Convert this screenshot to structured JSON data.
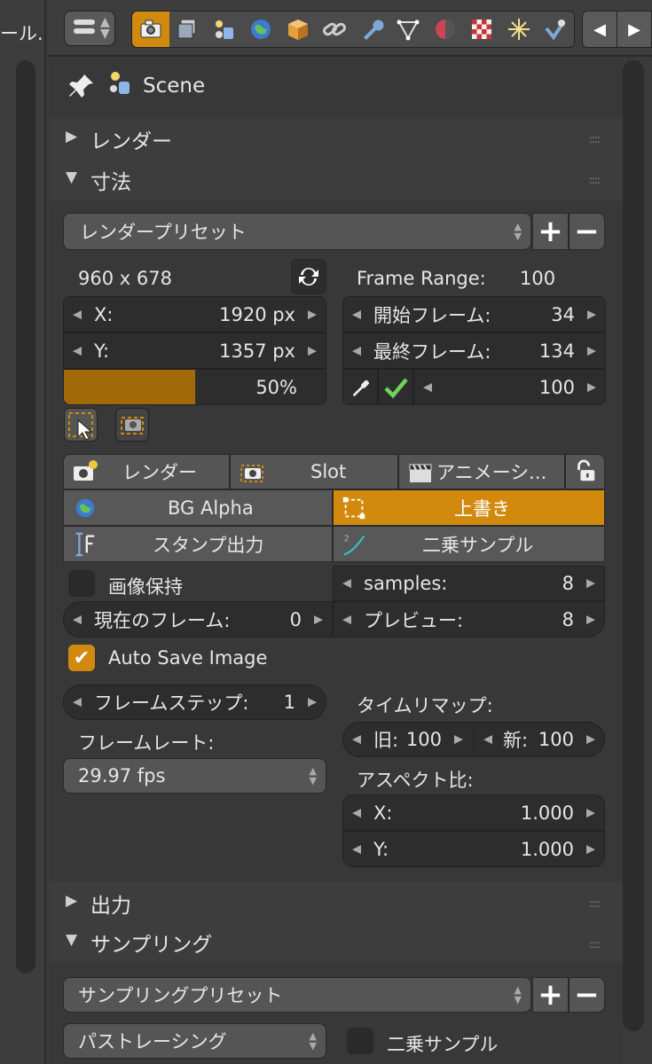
{
  "left_panel": {
    "label": "ール."
  },
  "panel": {
    "context_name": "Scene"
  },
  "sections": {
    "render": {
      "title": "レンダー"
    },
    "dimensions": {
      "title": "寸法"
    },
    "output": {
      "title": "出力"
    },
    "sampling": {
      "title": "サンプリング"
    }
  },
  "dimensions": {
    "preset": "レンダープリセット",
    "resolution_label": "960 x 678",
    "res_x_label": "X:",
    "res_x_value": "1920 px",
    "res_y_label": "Y:",
    "res_y_value": "1357 px",
    "percentage": "50%",
    "percentage_fraction": 0.5,
    "frame_range_label": "Frame Range:",
    "frame_range_value": "100",
    "start_label": "開始フレーム:",
    "start_value": "34",
    "end_label": "最終フレーム:",
    "end_value": "134",
    "step_value": "100"
  },
  "render_tabs": {
    "render": "レンダー",
    "slot": "Slot",
    "animation": "アニメーシ..."
  },
  "options": {
    "bg_alpha": "BG Alpha",
    "overwrite": "上書き",
    "stamp": "スタンプ出力",
    "square_samples": "二乗サンプル",
    "keep_image": "画像保持",
    "samples_label": "samples:",
    "samples_value": "8",
    "current_frame_label": "現在のフレーム:",
    "current_frame_value": "0",
    "preview_label": "プレビュー:",
    "preview_value": "8",
    "auto_save": "Auto Save Image"
  },
  "frame": {
    "step_label": "フレームステップ:",
    "step_value": "1",
    "rate_label": "フレームレート:",
    "rate_value": "29.97 fps",
    "remap_label": "タイムリマップ:",
    "old_label": "旧:",
    "old_value": "100",
    "new_label": "新:",
    "new_value": "100",
    "aspect_label": "アスペクト比:",
    "aspect_x_label": "X:",
    "aspect_x_value": "1.000",
    "aspect_y_label": "Y:",
    "aspect_y_value": "1.000"
  },
  "sampling": {
    "preset": "サンプリングプリセット",
    "integrator": "パストレーシング",
    "square_samples": "二乗サンプル"
  },
  "colors": {
    "accent": "#d18a0e",
    "panel": "#383838"
  }
}
